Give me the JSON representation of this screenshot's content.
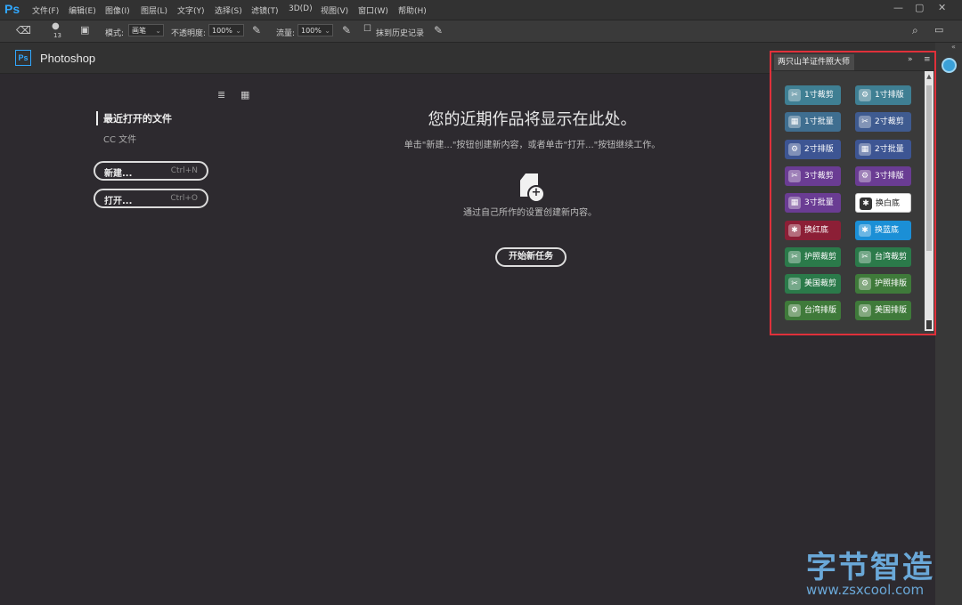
{
  "app": {
    "logo": "Ps",
    "title": "Photoshop"
  },
  "menu": [
    "文件(F)",
    "编辑(E)",
    "图像(I)",
    "图层(L)",
    "文字(Y)",
    "选择(S)",
    "滤镜(T)",
    "3D(D)",
    "视图(V)",
    "窗口(W)",
    "帮助(H)"
  ],
  "window_controls": {
    "minimize": "—",
    "maximize": "▢",
    "close": "✕"
  },
  "options": {
    "brush_size": "13",
    "mode_label": "模式:",
    "mode_value": "画笔",
    "opacity_label": "不透明度:",
    "opacity_value": "100%",
    "flow_label": "流量:",
    "flow_value": "100%",
    "erase_history": "抹到历史记录"
  },
  "home": {
    "recent_label": "最近打开的文件",
    "cc_label": "CC 文件",
    "new_label": "新建...",
    "new_shortcut": "Ctrl+N",
    "open_label": "打开...",
    "open_shortcut": "Ctrl+O",
    "headline": "您的近期作品将显示在此处。",
    "subline": "单击\"新建...\"按钮创建新内容，或者单击\"打开...\"按钮继续工作。",
    "desc": "通过自己所作的设置创建新内容。",
    "start_button": "开始新任务"
  },
  "panel": {
    "tab": "两只山羊证件照大师",
    "collapse": "»",
    "menu": "≡",
    "buttons": [
      {
        "label": "1寸裁剪",
        "color": "#3f7f93",
        "icon": "✂"
      },
      {
        "label": "1寸排版",
        "color": "#3f7f93",
        "icon": "⚙"
      },
      {
        "label": "1寸批量",
        "color": "#3f6e90",
        "icon": "▦"
      },
      {
        "label": "2寸裁剪",
        "color": "#3f5b90",
        "icon": "✂"
      },
      {
        "label": "2寸排版",
        "color": "#3d5593",
        "icon": "⚙"
      },
      {
        "label": "2寸批量",
        "color": "#3d5593",
        "icon": "▦"
      },
      {
        "label": "3寸裁剪",
        "color": "#6a3c93",
        "icon": "✂"
      },
      {
        "label": "3寸排版",
        "color": "#6a3c93",
        "icon": "⚙"
      },
      {
        "label": "3寸批量",
        "color": "#6a3c93",
        "icon": "▦"
      },
      {
        "label": "换白底",
        "color": "#ffffff",
        "icon": "✱",
        "dark": true
      },
      {
        "label": "换红底",
        "color": "#8c1f36",
        "icon": "✱"
      },
      {
        "label": "换蓝底",
        "color": "#1b8fd6",
        "icon": "✱"
      },
      {
        "label": "护照裁剪",
        "color": "#2b7a4a",
        "icon": "✂"
      },
      {
        "label": "台湾裁剪",
        "color": "#2b7a4a",
        "icon": "✂"
      },
      {
        "label": "美国裁剪",
        "color": "#2b7a4a",
        "icon": "✂"
      },
      {
        "label": "护照排版",
        "color": "#3f7a3a",
        "icon": "⚙"
      },
      {
        "label": "台湾排版",
        "color": "#3f7a3a",
        "icon": "⚙"
      },
      {
        "label": "美国排版",
        "color": "#3f7a3a",
        "icon": "⚙"
      }
    ]
  },
  "watermark": {
    "title": "字节智造",
    "url": "www.zsxcool.com"
  }
}
